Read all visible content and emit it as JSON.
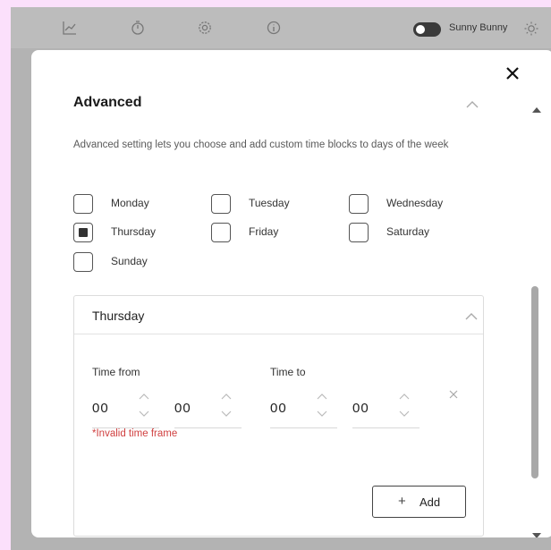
{
  "topbar": {
    "icons": [
      "chart-icon",
      "stopwatch-icon",
      "settings-icon",
      "info-icon"
    ],
    "theme_label": "Sunny Bunny",
    "toggle_on": false
  },
  "modal": {
    "section_title": "Advanced",
    "description": "Advanced setting lets you choose and add custom time blocks to days of the week",
    "days": [
      {
        "label": "Monday",
        "checked": false
      },
      {
        "label": "Tuesday",
        "checked": false
      },
      {
        "label": "Wednesday",
        "checked": false
      },
      {
        "label": "Thursday",
        "checked": true
      },
      {
        "label": "Friday",
        "checked": false
      },
      {
        "label": "Saturday",
        "checked": false
      },
      {
        "label": "Sunday",
        "checked": false
      }
    ],
    "panel": {
      "title": "Thursday",
      "time_from_label": "Time from",
      "time_to_label": "Time to",
      "from_hours": "00",
      "from_minutes": "00",
      "to_hours": "00",
      "to_minutes": "00",
      "error": "*Invalid time frame",
      "add_label": "Add"
    }
  },
  "colors": {
    "page_bg": "#fbe0fb",
    "overlay": "#b3b3b3",
    "error": "#d04040",
    "toggle": "#3a3a3a"
  }
}
